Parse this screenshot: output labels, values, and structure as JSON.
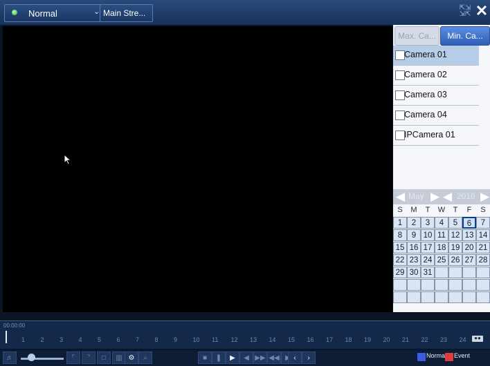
{
  "toolbar": {
    "mode_label": "Normal",
    "stream_label": "Main Stre...",
    "fullscreen_icon": "fullscreen-icon",
    "close_icon": "close-icon"
  },
  "tabs": {
    "max_label": "Max. Ca...",
    "min_label": "Min. Ca..."
  },
  "cameras": [
    "Camera 01",
    "Camera 02",
    "Camera 03",
    "Camera 04",
    "IPCamera 01"
  ],
  "calendar": {
    "month": "May",
    "year": "2016",
    "weekdays": [
      "S",
      "M",
      "T",
      "W",
      "T",
      "F",
      "S"
    ],
    "days": [
      "1",
      "2",
      "3",
      "4",
      "5",
      "6",
      "7",
      "8",
      "9",
      "10",
      "11",
      "12",
      "13",
      "14",
      "15",
      "16",
      "17",
      "18",
      "19",
      "20",
      "21",
      "22",
      "23",
      "24",
      "25",
      "26",
      "27",
      "28",
      "29",
      "30",
      "31",
      "",
      "",
      "",
      "",
      "",
      "",
      "",
      "",
      "",
      "",
      "",
      "",
      "",
      "",
      "",
      "",
      "",
      ""
    ]
  },
  "timeline": {
    "time": "00:00:00",
    "hours": [
      "1",
      "2",
      "3",
      "4",
      "5",
      "6",
      "7",
      "8",
      "9",
      "10",
      "11",
      "12",
      "13",
      "14",
      "15",
      "16",
      "17",
      "18",
      "19",
      "20",
      "21",
      "22",
      "23",
      "24"
    ]
  },
  "legend": {
    "normal": "Normal",
    "event": "Event"
  },
  "colors": {
    "normal": "#3e5ae0",
    "event": "#e23a3a",
    "accent": "#2f5fb8"
  }
}
